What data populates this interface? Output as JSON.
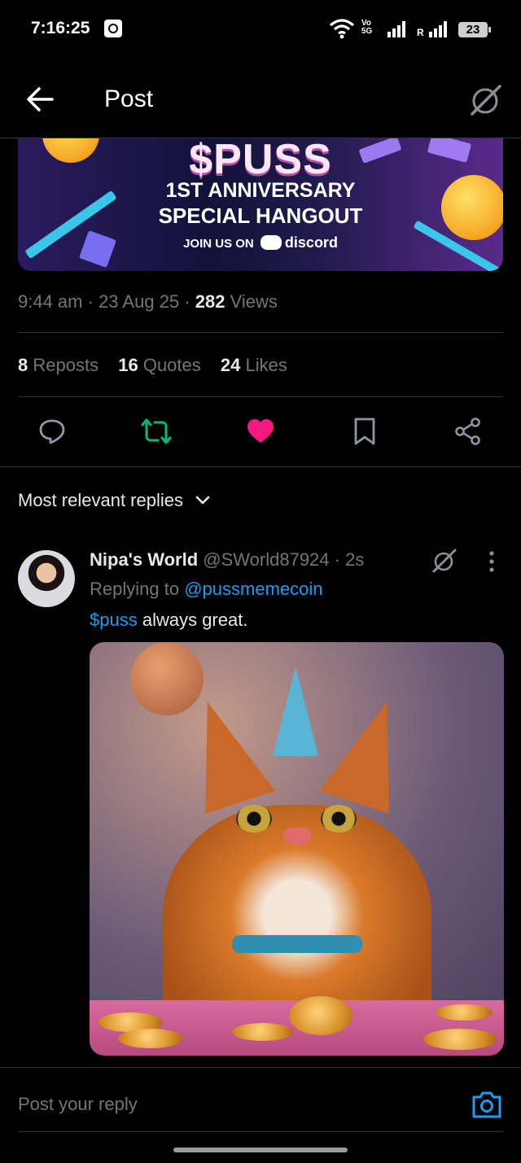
{
  "status_bar": {
    "time": "7:16:25",
    "network_label": "Vo\n5G",
    "roaming_label": "R",
    "battery": "23"
  },
  "header": {
    "title": "Post"
  },
  "banner": {
    "brand": "$PUSS",
    "line1": "1ST ANNIVERSARY",
    "line2": "SPECIAL HANGOUT",
    "join_text": "JOIN US ON",
    "platform": "discord"
  },
  "post_meta": {
    "time": "9:44 am",
    "date": "23 Aug 25",
    "views_count": "282",
    "views_label": "Views"
  },
  "stats": {
    "reposts_count": "8",
    "reposts_label": "Reposts",
    "quotes_count": "16",
    "quotes_label": "Quotes",
    "likes_count": "24",
    "likes_label": "Likes"
  },
  "actions": {
    "reply_icon": "speech-bubble-icon",
    "repost_icon": "repost-icon",
    "like_icon": "heart-filled-icon",
    "bookmark_icon": "bookmark-icon",
    "share_icon": "share-icon",
    "repost_color": "#00ba7c",
    "like_color": "#f91880"
  },
  "replies": {
    "sort_label": "Most relevant replies",
    "items": [
      {
        "name": "Nipa's World",
        "handle": "@SWorld87924",
        "time": "2s",
        "replying_prefix": "Replying to",
        "replying_to": "@pussmemecoin",
        "text_link": "$puss",
        "text_rest": " always great."
      }
    ]
  },
  "composer": {
    "placeholder": "Post your reply"
  },
  "colors": {
    "background": "#000000",
    "text_primary": "#e7e9ea",
    "text_secondary": "#71767b",
    "link": "#1d9bf0",
    "divider": "#2f3336"
  }
}
